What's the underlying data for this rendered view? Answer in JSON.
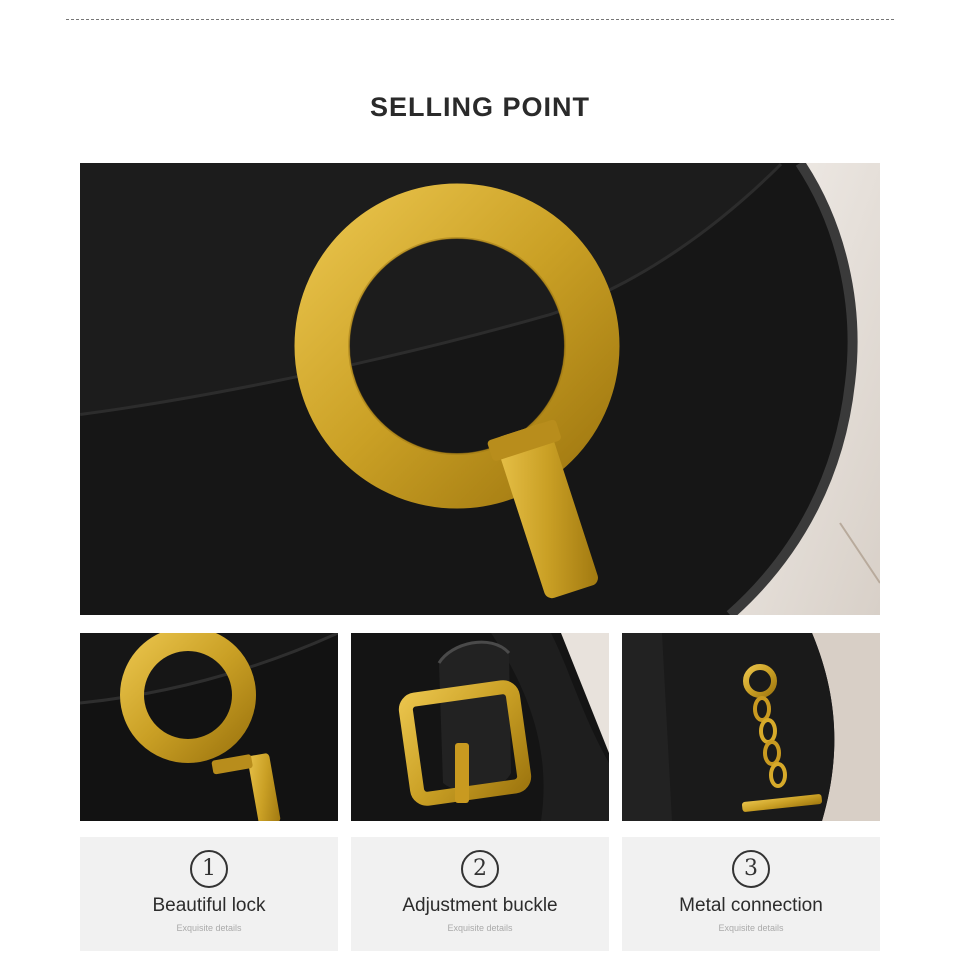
{
  "header": {
    "title": "SELLING POINT"
  },
  "colors": {
    "gold": "#d9a92a",
    "leather": "#141414",
    "card_bg": "#f1f1f1",
    "text": "#2c2c2c",
    "subtext": "#aaaaaa"
  },
  "images": {
    "hero": "gold-ring-lock-closeup",
    "thumbs": [
      "ring-lock-detail",
      "buckle-strap-detail",
      "chain-connection-detail"
    ]
  },
  "features": [
    {
      "number": "1",
      "title": "Beautiful lock",
      "subtitle": "Exquisite details"
    },
    {
      "number": "2",
      "title": "Adjustment buckle",
      "subtitle": "Exquisite details"
    },
    {
      "number": "3",
      "title": "Metal connection",
      "subtitle": "Exquisite details"
    }
  ]
}
